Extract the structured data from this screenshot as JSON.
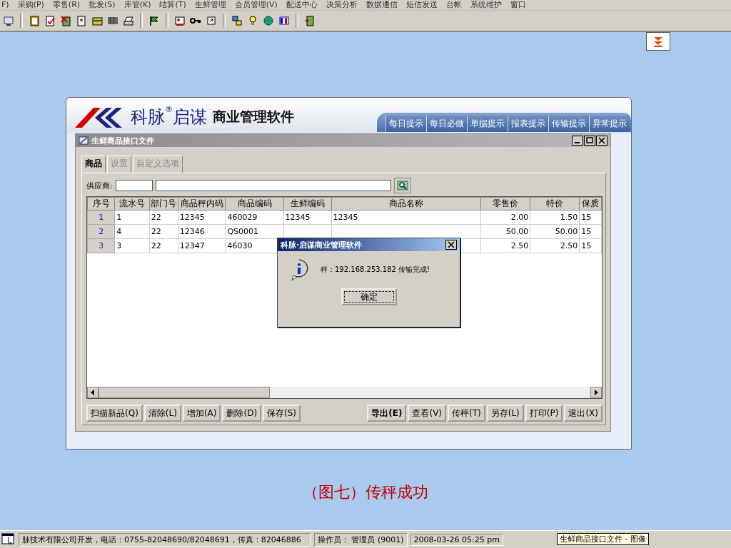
{
  "menu_bar": [
    "F)",
    "采购(P)",
    "零售(R)",
    "批发(S)",
    "库管(K)",
    "结算(T)",
    "生鲜管理",
    "会员管理(V)",
    "配送中心",
    "决策分析",
    "数据通信",
    "短信发送",
    "台帐",
    "系统维护",
    "窗口"
  ],
  "main_window": {
    "logo_brand": "科脉",
    "logo_mark": "®",
    "logo_brand2": "启谋",
    "logo_subtitle": "商业管理软件",
    "tip_tabs": [
      {
        "label": "每日提示",
        "selected": false
      },
      {
        "label": "每日必做",
        "selected": false
      },
      {
        "label": "单据提示",
        "selected": false
      },
      {
        "label": "报表提示",
        "selected": false
      },
      {
        "label": "传输提示",
        "selected": false
      },
      {
        "label": "异常提示",
        "selected": false
      }
    ]
  },
  "child_window": {
    "title": "生鲜商品接口文件",
    "tabs": [
      {
        "label": "商品",
        "selected": true,
        "disabled": false
      },
      {
        "label": "设置",
        "selected": false,
        "disabled": true
      },
      {
        "label": "自定义选项",
        "selected": false,
        "disabled": true
      }
    ],
    "supplier": {
      "label": "供应商:"
    },
    "table": {
      "columns": [
        "序号",
        "流水号",
        "部门号",
        "商品秤内码",
        "商品编码",
        "生鲜编码",
        "商品名称",
        "零售价",
        "特价",
        "保质"
      ],
      "rows": [
        [
          "1",
          "1",
          "22",
          "12345",
          "460029",
          "12345",
          "12345",
          "2.00",
          "1.50",
          "15"
        ],
        [
          "2",
          "4",
          "22",
          "12346",
          "QS0001",
          "",
          "",
          "50.00",
          "50.00",
          "15"
        ],
        [
          "3",
          "3",
          "22",
          "12347",
          "46030",
          "",
          "",
          "2.50",
          "2.50",
          "15"
        ]
      ]
    },
    "left_buttons": [
      {
        "label": "扫描新品(Q)",
        "bold": false
      },
      {
        "label": "清除(L)",
        "bold": false
      },
      {
        "label": "增加(A)",
        "bold": false
      },
      {
        "label": "删除(D)",
        "bold": false
      },
      {
        "label": "保存(S)",
        "bold": false
      }
    ],
    "right_buttons": [
      {
        "label": "导出(E)",
        "bold": true
      },
      {
        "label": "查看(V)",
        "bold": false
      },
      {
        "label": "传秤(T)",
        "bold": false
      },
      {
        "label": "另存(L)",
        "bold": false
      },
      {
        "label": "打印(P)",
        "bold": false
      },
      {
        "label": "退出(X)",
        "bold": false
      }
    ]
  },
  "dialog": {
    "title": "科脉·启谋商业管理软件",
    "message": "秤：192.168.253.182 传输完成!",
    "button": "确定"
  },
  "caption": "（图七）传秤成功",
  "status_bar": {
    "company": "脉技术有限公司开发，电话：0755-82048690/82048691，传真：82046886",
    "operator": "操作员： 管理员 (9001)",
    "datetime": "2008-03-26 05:25 pm",
    "tooltip": "生鲜商品接口文件 - 图像"
  }
}
